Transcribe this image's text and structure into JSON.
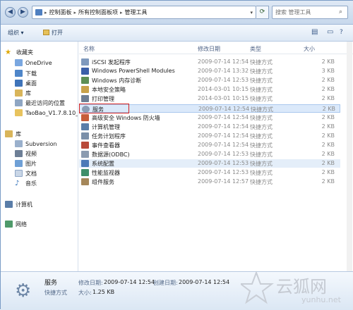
{
  "address": {
    "crumbs": [
      "控制面板",
      "所有控制面板项",
      "管理工具"
    ],
    "search_placeholder": "搜索 管理工具"
  },
  "toolbar": {
    "organize": "组织 ▾",
    "open": "打开"
  },
  "nav": {
    "favorites": "收藏夹",
    "onedrive": "OneDrive",
    "downloads": "下载",
    "desktop": "桌面",
    "library_fav": "库",
    "recent": "最近访问的位置",
    "taobao": "TaoBao_V1.7.8.10_",
    "libraries": "库",
    "subversion": "Subversion",
    "videos": "视频",
    "pictures": "图片",
    "documents": "文档",
    "music": "音乐",
    "computer": "计算机",
    "network": "网络"
  },
  "columns": {
    "name": "名称",
    "date": "修改日期",
    "type": "类型",
    "size": "大小"
  },
  "files": [
    {
      "name": "iSCSI 发起程序",
      "date": "2009-07-14 12:54",
      "type": "快捷方式",
      "size": "2 KB"
    },
    {
      "name": "Windows PowerShell Modules",
      "date": "2009-07-14 13:32",
      "type": "快捷方式",
      "size": "3 KB"
    },
    {
      "name": "Windows 内存诊断",
      "date": "2009-07-14 12:53",
      "type": "快捷方式",
      "size": "2 KB"
    },
    {
      "name": "本地安全策略",
      "date": "2014-03-01 10:15",
      "type": "快捷方式",
      "size": "2 KB"
    },
    {
      "name": "打印管理",
      "date": "2014-03-01 10:15",
      "type": "快捷方式",
      "size": "2 KB"
    },
    {
      "name": "服务",
      "date": "2009-07-14 12:54",
      "type": "快捷方式",
      "size": "2 KB"
    },
    {
      "name": "高级安全 Windows 防火墙",
      "date": "2009-07-14 12:54",
      "type": "快捷方式",
      "size": "2 KB"
    },
    {
      "name": "计算机管理",
      "date": "2009-07-14 12:54",
      "type": "快捷方式",
      "size": "2 KB"
    },
    {
      "name": "任务计划程序",
      "date": "2009-07-14 12:54",
      "type": "快捷方式",
      "size": "2 KB"
    },
    {
      "name": "事件查看器",
      "date": "2009-07-14 12:54",
      "type": "快捷方式",
      "size": "2 KB"
    },
    {
      "name": "数据源(ODBC)",
      "date": "2009-07-14 12:53",
      "type": "快捷方式",
      "size": "2 KB"
    },
    {
      "name": "系统配置",
      "date": "2009-07-14 12:53",
      "type": "快捷方式",
      "size": "2 KB"
    },
    {
      "name": "性能监视器",
      "date": "2009-07-14 12:53",
      "type": "快捷方式",
      "size": "2 KB"
    },
    {
      "name": "组件服务",
      "date": "2009-07-14 12:57",
      "type": "快捷方式",
      "size": "2 KB"
    }
  ],
  "details": {
    "name": "服务",
    "kind": "快捷方式",
    "modified_label": "修改日期:",
    "modified": "2009-07-14 12:54",
    "created_label": "创建日期:",
    "created": "2009-07-14 12:54",
    "size_label": "大小:",
    "size": "1.25 KB"
  },
  "watermark": {
    "text": "云狐网",
    "url": "yunhu.net"
  }
}
